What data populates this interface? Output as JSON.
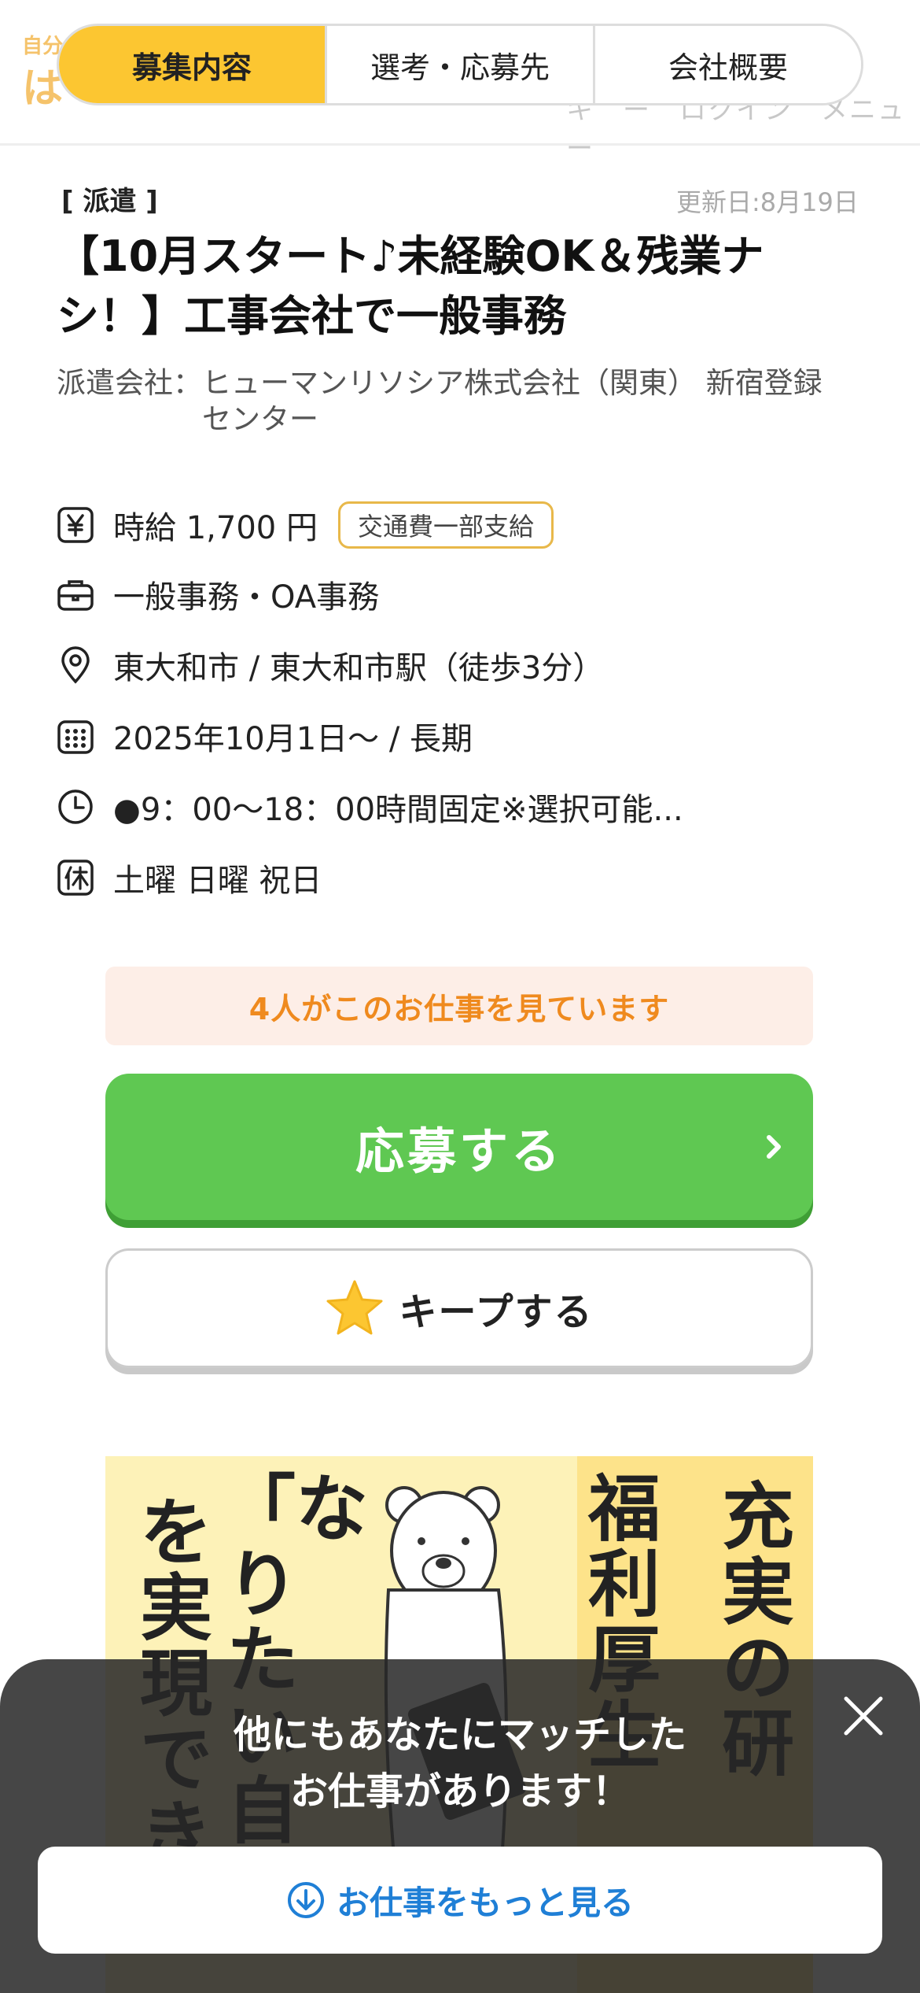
{
  "header": {
    "logo_small": "自分",
    "logo_big": "は",
    "ghost_text": "キ　ー　ロクイン　メニュー",
    "tabs": [
      {
        "label": "募集内容",
        "active": true
      },
      {
        "label": "選考・応募先",
        "active": false
      },
      {
        "label": "会社概要",
        "active": false
      }
    ]
  },
  "job": {
    "type_tag": "[ 派遣 ]",
    "updated": "更新日:8月19日",
    "title": "【10月スタート♪未経験OK＆残業ナシ！】工事会社で一般事務",
    "company_label": "派遣会社：",
    "company_name": "ヒューマンリソシア株式会社（関東） 新宿登録センター",
    "details": {
      "wage": {
        "icon": "yen-icon",
        "text": "時給 1,700 円",
        "badge": "交通費一部支給"
      },
      "category": {
        "icon": "briefcase-icon",
        "text": "一般事務・OA事務"
      },
      "location": {
        "icon": "map-pin-icon",
        "text": "東大和市 / 東大和市駅（徒歩3分）"
      },
      "period": {
        "icon": "calendar-icon",
        "text": "2025年10月1日〜 / 長期"
      },
      "hours": {
        "icon": "clock-icon",
        "text": "●9：00〜18：00時間固定※選択可能..."
      },
      "holidays": {
        "icon": "holiday-icon",
        "text": "土曜 日曜 祝日"
      }
    }
  },
  "notice": "4人がこのお仕事を見ています",
  "apply_label": "応募する",
  "keep_label": "キープする",
  "banner": {
    "col1": "充実の研",
    "col2": "福利厚生",
    "col3": "「なりたい自",
    "col4": "を実現でき"
  },
  "bottom_sheet": {
    "message_line1": "他にもあなたにマッチした",
    "message_line2": "お仕事があります！",
    "more_label": "お仕事をもっと見る"
  },
  "colors": {
    "accent_yellow": "#fcc631",
    "apply_green": "#5fc852",
    "notice_orange": "#ef8a1e",
    "link_blue": "#1f7fd6"
  }
}
